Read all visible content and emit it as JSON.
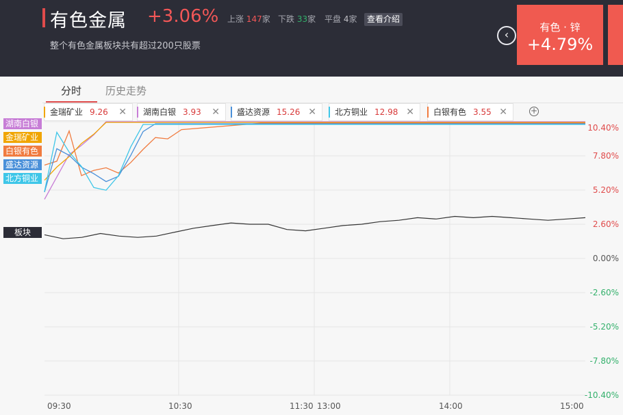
{
  "header": {
    "title": "有色金属",
    "change": "+3.06%",
    "up_label": "上涨",
    "up_count": "147",
    "up_unit": "家",
    "down_label": "下跌",
    "down_count": "33",
    "down_unit": "家",
    "flat_label": "平盘",
    "flat_count": "4",
    "flat_unit": "家",
    "intro_button": "查看介绍",
    "subtitle": "整个有色金属板块共有超过200只股票",
    "prev_icon": "chevron-left-icon",
    "card": {
      "name": "有色 · 锌",
      "pct": "+4.79%"
    }
  },
  "tabs": [
    "分时",
    "历史走势"
  ],
  "chips": [
    {
      "name": "金瑞矿业",
      "value": "9.26",
      "color": "#f0a500"
    },
    {
      "name": "湖南白银",
      "value": "3.93",
      "color": "#c77dd6"
    },
    {
      "name": "盛达资源",
      "value": "15.26",
      "color": "#4a90d9"
    },
    {
      "name": "北方铜业",
      "value": "12.98",
      "color": "#3ec6e8"
    },
    {
      "name": "白银有色",
      "value": "3.55",
      "color": "#f07b3f"
    }
  ],
  "add_icon": "plus-circle-icon",
  "close_icon": "close-icon",
  "chart_data": {
    "type": "line",
    "y_ticks": [
      "10.40%",
      "7.80%",
      "5.20%",
      "2.60%",
      "0.00%",
      "-2.60%",
      "-5.20%",
      "-7.80%",
      "-10.40%"
    ],
    "x_ticks": [
      "09:30",
      "10:30",
      "11:30",
      "13:00",
      "14:00",
      "15:00"
    ],
    "ylim": [
      -10.4,
      10.4
    ],
    "grid": true,
    "colors": {
      "up": "#e04b4b",
      "zero": "#555555",
      "down": "#33b06b",
      "board": "#333333"
    },
    "series": [
      {
        "name": "湖南白银",
        "color": "#c77dd6",
        "values": [
          4.5,
          6.2,
          7.9,
          8.6,
          9.4,
          10.4,
          10.4,
          10.4,
          10.4,
          10.4,
          10.4,
          10.4,
          10.4,
          10.4,
          10.4,
          10.4,
          10.4
        ]
      },
      {
        "name": "金瑞矿业",
        "color": "#f0a500",
        "values": [
          6.0,
          7.0,
          7.8,
          8.8,
          9.5,
          10.4,
          10.4,
          10.4,
          10.4,
          10.4,
          10.4,
          10.4,
          10.4,
          10.4,
          10.4,
          10.4,
          10.4
        ]
      },
      {
        "name": "白银有色",
        "color": "#f07b3f",
        "values": [
          7.2,
          7.5,
          9.8,
          6.4,
          6.8,
          7.0,
          6.6,
          7.4,
          8.4,
          9.3,
          9.2,
          9.9,
          10.4,
          10.4,
          10.4,
          10.4,
          10.4
        ]
      },
      {
        "name": "盛达资源",
        "color": "#4a90d9",
        "values": [
          5.2,
          8.5,
          8.0,
          7.1,
          6.6,
          6.0,
          6.4,
          8.0,
          9.8,
          10.4,
          10.4,
          10.4,
          10.4,
          10.4,
          10.4,
          10.4,
          10.4
        ]
      },
      {
        "name": "北方铜业",
        "color": "#3ec6e8",
        "values": [
          5.3,
          9.8,
          8.3,
          7.2,
          5.6,
          5.4,
          6.5,
          8.7,
          10.4,
          10.4,
          10.4,
          10.4,
          10.4,
          10.4,
          10.4,
          10.4,
          10.4
        ]
      },
      {
        "name": "板块",
        "color": "#333333",
        "values": [
          1.8,
          1.5,
          1.6,
          1.9,
          1.7,
          1.6,
          1.7,
          2.0,
          2.3,
          2.5,
          2.7,
          2.6,
          2.6,
          2.2,
          2.1,
          2.3,
          2.5,
          2.6,
          2.8,
          2.9,
          3.1,
          3.0,
          3.2,
          3.1,
          3.2,
          3.1,
          3.0,
          2.9,
          3.0,
          3.1
        ]
      }
    ]
  }
}
